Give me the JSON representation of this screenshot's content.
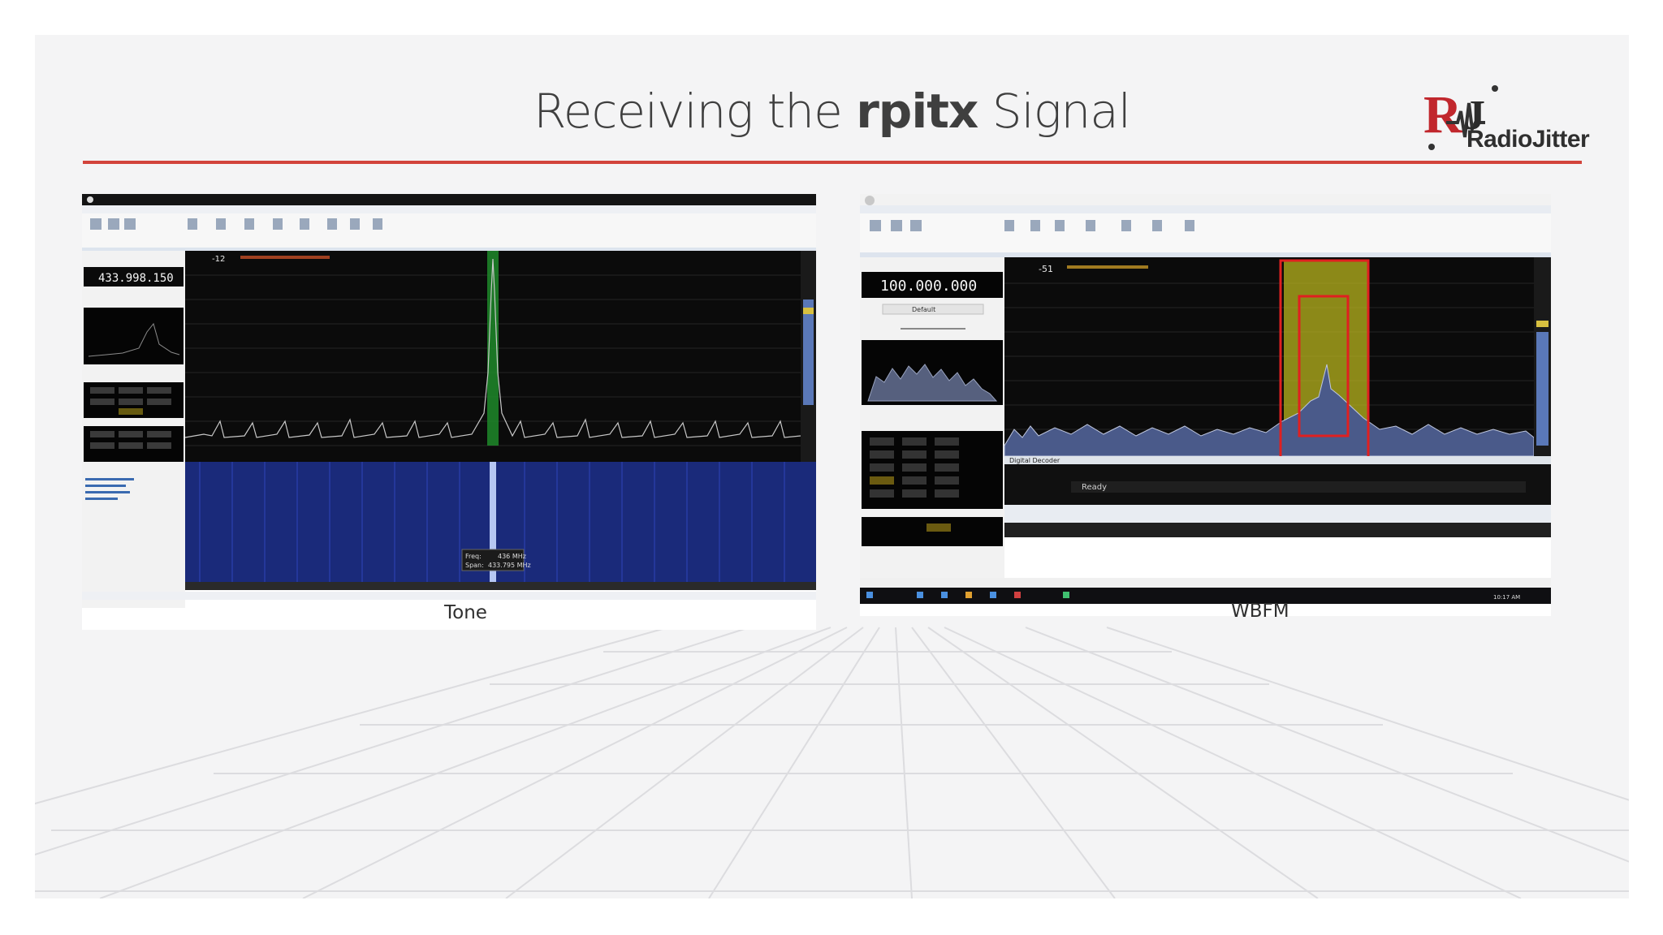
{
  "slide": {
    "title_prefix": "Receiving the",
    "title_bold": "rpitx",
    "title_suffix": "Signal",
    "logo_text": "RadioJitter",
    "logo_mark": "RJ"
  },
  "left_screenshot": {
    "caption": "Tone",
    "frequency_display": "433.998.150",
    "level_readout": "-12",
    "tooltip_freq_label": "Freq:",
    "tooltip_freq_value": "436 MHz",
    "tooltip_span_label": "Span:",
    "tooltip_span_value": "433.795 MHz"
  },
  "right_screenshot": {
    "caption": "WBFM",
    "frequency_display": "100.000.000",
    "level_readout": "-51",
    "mode_dropdown": "Default",
    "panel_digital_decoder": "Digital Decoder",
    "status_ready": "Ready",
    "taskbar_time": "10:17 AM"
  },
  "colors": {
    "accent_rule": "#d2433b",
    "spectrum_bg": "#0b0b0b",
    "waterfall_bg": "#1a2a7a",
    "selection_yellow": "#c8c020",
    "selection_red": "#e02020"
  }
}
